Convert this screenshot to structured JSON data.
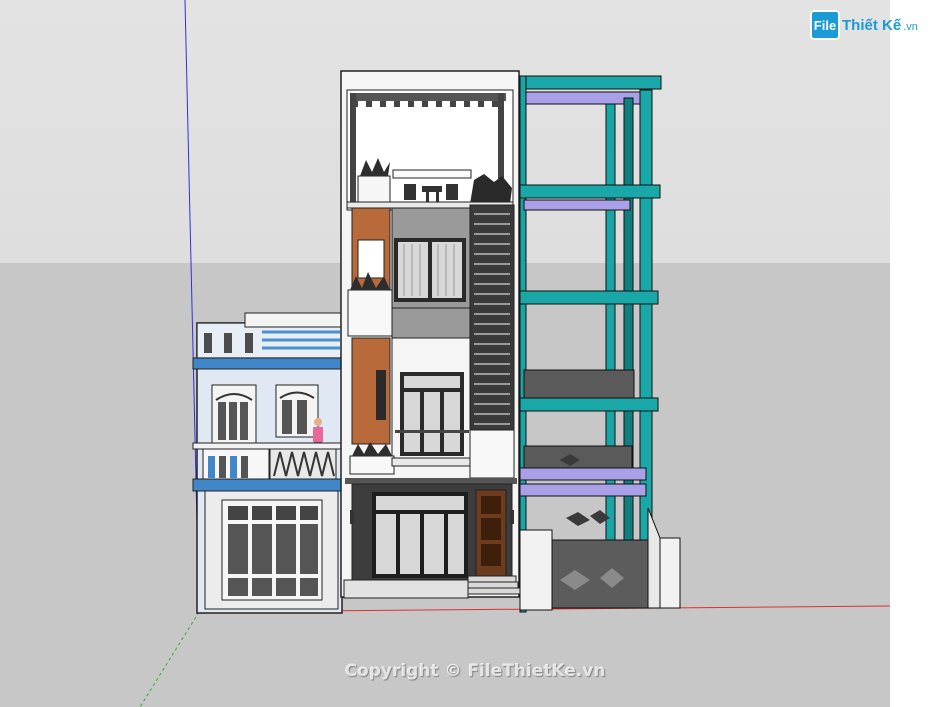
{
  "watermark": {
    "logo_badge": "File",
    "logo_name": "Thiết Kế",
    "logo_domain": ".vn",
    "copyright": "Copyright © FileThietKe.vn"
  },
  "colors": {
    "sky": "#e0e0e0",
    "ground": "#c7c7c7",
    "axis_red": "#e03030",
    "axis_blue": "#3030e0",
    "axis_green": "#30b030",
    "steel_cyan": "#19a7a7",
    "slab_purple": "#a9a0e8",
    "house_blue": "#3f87c9"
  },
  "icons": {
    "marker": "✦"
  }
}
